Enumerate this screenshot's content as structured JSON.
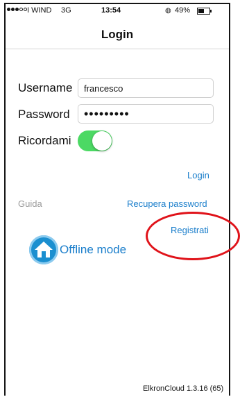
{
  "status_bar": {
    "carrier": "I WIND",
    "network": "3G",
    "time": "13:54",
    "battery_pct": "49%",
    "battery_level": 0.49
  },
  "navbar": {
    "title": "Login"
  },
  "form": {
    "username_label": "Username",
    "username_value": "francesco",
    "password_label": "Password",
    "password_value": "•••••••••",
    "remember_label": "Ricordami",
    "remember_on": true
  },
  "links": {
    "login": "Login",
    "guide": "Guida",
    "recover_password": "Recupera password",
    "register": "Registrati",
    "offline_mode": "Offline mode"
  },
  "footer": {
    "version": "ElkronCloud 1.3.16 (65)"
  },
  "colors": {
    "accent": "#1a7ecb",
    "toggle_on": "#4cd964",
    "annotation": "#e0131a"
  }
}
